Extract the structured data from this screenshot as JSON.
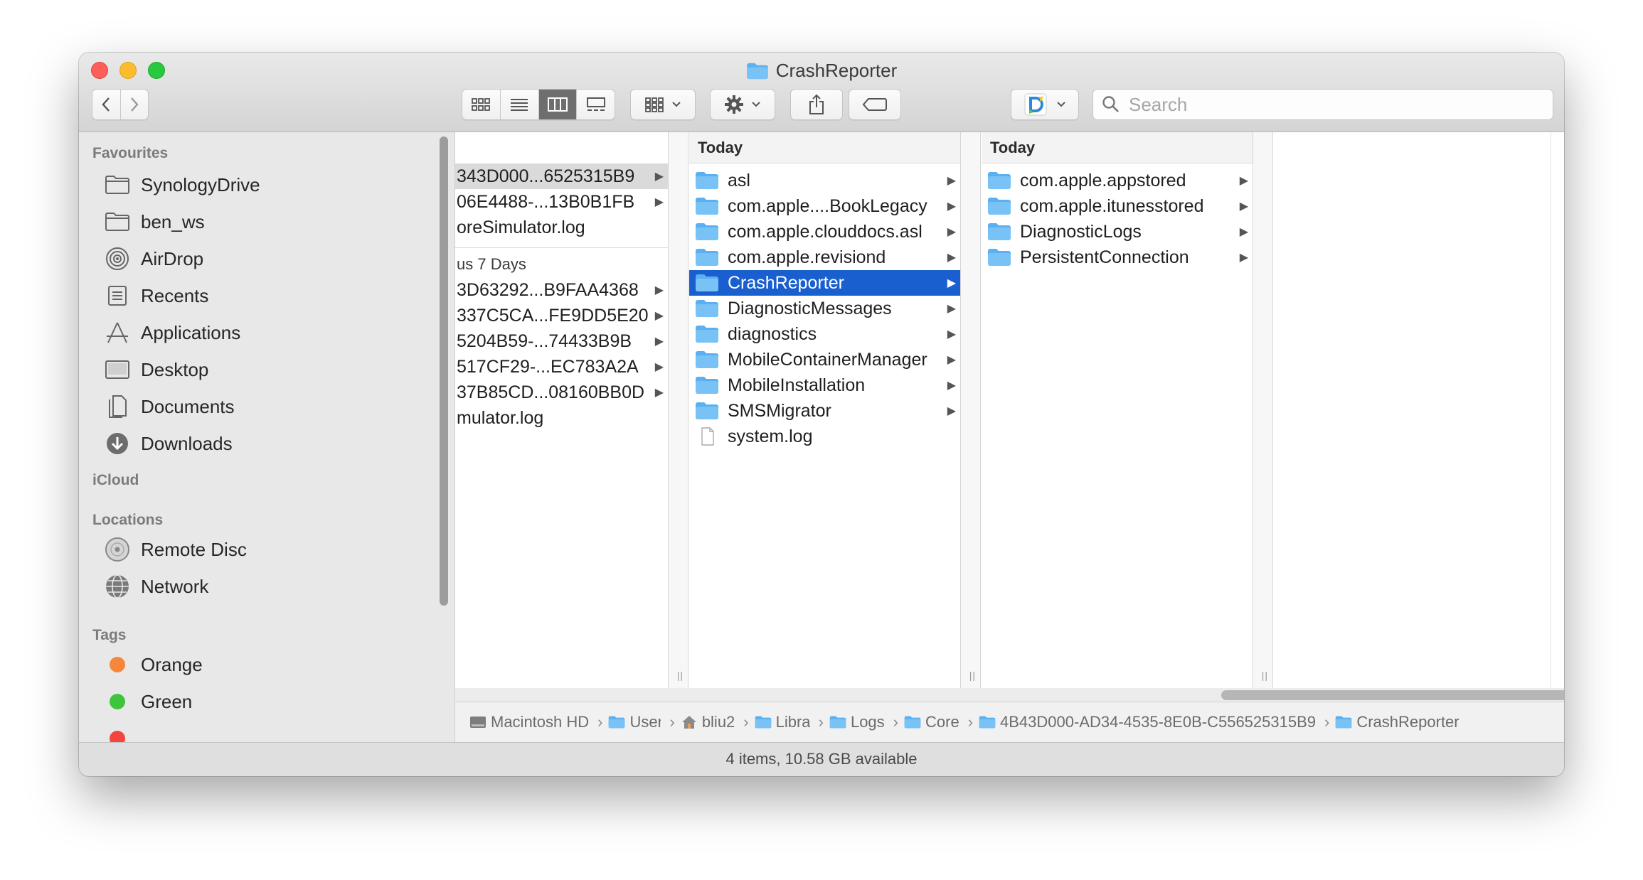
{
  "window": {
    "title": "CrashReporter"
  },
  "toolbar": {
    "search_placeholder": "Search"
  },
  "sidebar": {
    "sections": {
      "favourites": "Favourites",
      "icloud": "iCloud",
      "locations": "Locations",
      "tags": "Tags"
    },
    "favourites": [
      "SynologyDrive",
      "ben_ws",
      "AirDrop",
      "Recents",
      "Applications",
      "Desktop",
      "Documents",
      "Downloads"
    ],
    "locations": [
      "Remote Disc",
      "Network"
    ],
    "tags": [
      {
        "label": "Orange",
        "color": "#f5863a"
      },
      {
        "label": "Green",
        "color": "#3ec53d"
      }
    ]
  },
  "column1": {
    "rows_top": [
      "343D000...6525315B9",
      "06E4488-...13B0B1FB",
      "oreSimulator.log"
    ],
    "section": "us 7 Days",
    "rows_bottom": [
      "3D63292...B9FAA4368",
      "337C5CA...FE9DD5E20",
      "5204B59-...74433B9B",
      "517CF29-...EC783A2A",
      "37B85CD...08160BB0D",
      "mulator.log"
    ]
  },
  "column2": {
    "header": "Today",
    "rows": [
      "asl",
      "com.apple....BookLegacy",
      "com.apple.clouddocs.asl",
      "com.apple.revisiond",
      "CrashReporter",
      "DiagnosticMessages",
      "diagnostics",
      "MobileContainerManager",
      "MobileInstallation",
      "SMSMigrator",
      "system.log"
    ]
  },
  "column3": {
    "header": "Today",
    "rows": [
      "com.apple.appstored",
      "com.apple.itunesstored",
      "DiagnosticLogs",
      "PersistentConnection"
    ]
  },
  "pathbar": [
    "Macintosh HD",
    "User",
    "bliu2",
    "Libra",
    "Logs",
    "Core",
    "4B43D000-AD34-4535-8E0B-C556525315B9",
    "CrashReporter"
  ],
  "status": "4 items, 10.58 GB available",
  "colors": {
    "selection": "#1a5fd0",
    "folder": "#5ab0f0"
  }
}
